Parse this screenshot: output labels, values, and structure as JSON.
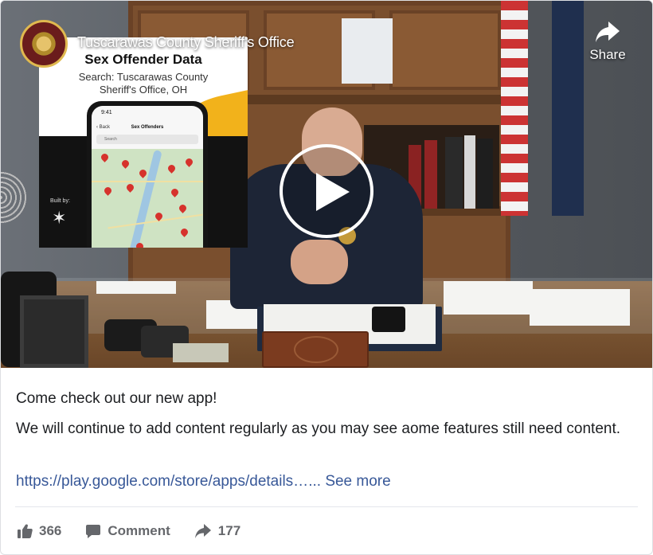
{
  "video": {
    "channel_name": "Tuscarawas County Sheriff's Office",
    "share_label": "Share",
    "promo": {
      "title": "Sex Offender Data",
      "subtitle_line1": "Search: Tuscarawas County",
      "subtitle_line2": "Sheriff's Office, OH",
      "phone_time": "9:41",
      "phone_back": "Back",
      "phone_title": "Sex Offenders",
      "phone_search": "Search",
      "built_by": "Built by:"
    }
  },
  "post": {
    "line1": "Come check out our new app!",
    "line2": "We will continue to add content regularly as you may see aome features still need content.",
    "link": "https://play.google.com/store/apps/details…",
    "ellipsis": "...",
    "see_more": "See more"
  },
  "actions": {
    "like_count": "366",
    "comment_label": "Comment",
    "share_count": "177"
  },
  "icons": {
    "like": "thumbs-up-icon",
    "comment": "comment-bubble-icon",
    "share": "share-arrow-icon",
    "play": "play-icon"
  },
  "colors": {
    "link": "#385898",
    "action_gray": "#65676b",
    "divider": "#e4e6eb"
  }
}
